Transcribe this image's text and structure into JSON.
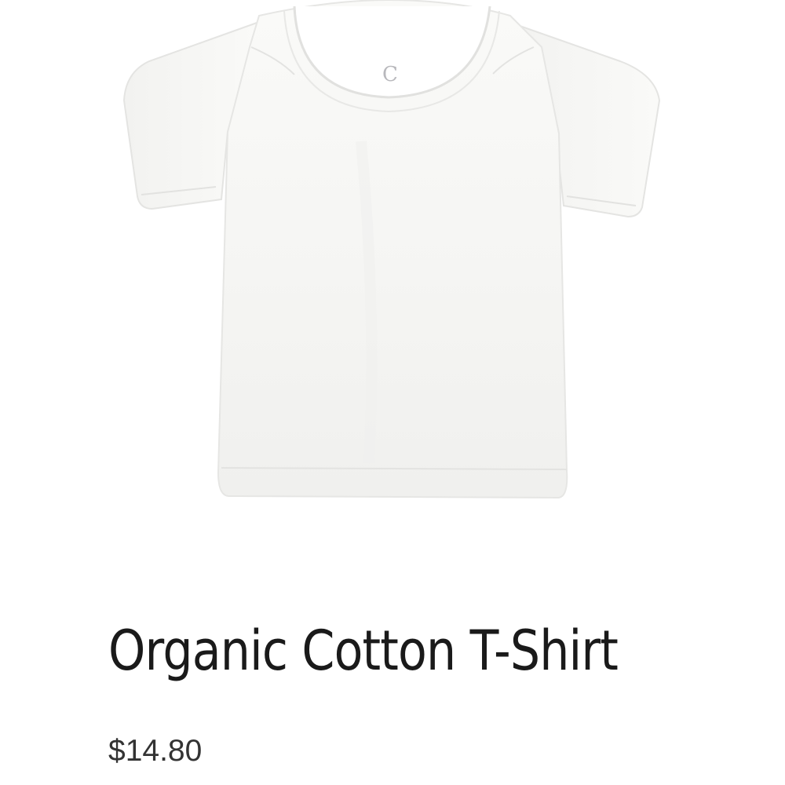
{
  "product": {
    "image_icon": "white-short-sleeve-tshirt-icon",
    "brand_logo": "C",
    "title": "Organic Cotton T-Shirt",
    "price": "$14.80"
  },
  "colors": {
    "shirt": "#f7f7f5",
    "shirt_shadow": "#e7e7e5",
    "text": "#1a1a1a",
    "price_text": "#333333",
    "background": "#ffffff"
  }
}
